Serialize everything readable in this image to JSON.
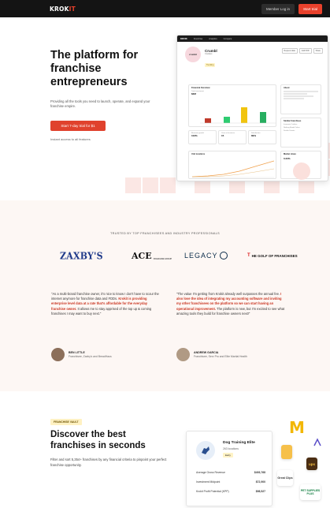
{
  "nav": {
    "logo_main": "KROK",
    "logo_accent": "IT",
    "login_label": "Member Log in",
    "trial_label": "Start trial"
  },
  "hero": {
    "title": "The platform for franchise entrepreneurs",
    "subtitle": "Providing all the tools you need to launch, operate, and expand your franchise empire.",
    "cta_label": "Start 7-day trial for $1",
    "instant_text": "Instant access to all features"
  },
  "dashboard": {
    "tabs_top": [
      "Franchise",
      "Analytics",
      "Compare"
    ],
    "brand_name": "Crumbl",
    "brand_logo_text": "crumbl",
    "brand_subtitle": "Cookies",
    "brand_badge": "Trending",
    "view_tabs": [
      "Request data",
      "Add FDD",
      "Share"
    ],
    "card_financial": {
      "title": "Financial Overview",
      "label": "Total investment",
      "value": "$2M"
    },
    "card_about": {
      "title": "About"
    },
    "card_similar": {
      "title": "Similar franchises",
      "items": [
        "Insomnia Cookies",
        "Nothing Bundt Cakes",
        "Dunkin Donuts"
      ]
    },
    "stats": [
      {
        "value": "103%",
        "label": "Revenue growth"
      },
      {
        "value": "15",
        "label": "Years in business"
      },
      {
        "value": "89%",
        "label": "Satisfaction"
      }
    ],
    "card_locations": {
      "title": "Unit locations"
    },
    "card_market": {
      "title": "Market share",
      "value": "0.23%"
    }
  },
  "trusted": {
    "label": "TRUSTED BY TOP FRANCHISEES AND INDUSTRY PROFESSIONALS",
    "brands": {
      "zaxbys": "ZAXBY'S",
      "ace": "ACE",
      "ace_sub": "FRANCHISE GROUP",
      "legacy": "LEGACY",
      "golf_tee": "T",
      "golf": "HE GOLF OF FRANCHISES"
    },
    "quote1": {
      "pre": "\"As a multi-brand franchise owner, it's nice to know I don't have to scour the internet anymore for franchise data and FDDs. ",
      "highlight": "Krokit is providing enterprise level data at a rate that's affordable for the everyday franchise owner.",
      "post": " It allows me to stay apprised of the top up & coming franchises I may want to buy next.\""
    },
    "quote2": {
      "pre": "\"The value I'm getting from Krokit already well surpasses the annual fee. ",
      "highlight": "I also love the idea of integrating my accounting software and inviting my other franchisees on the platform so we can start having an operational improvement.",
      "post": " The platform is new, but I'm excited to see what amazing tools they build for franchise owners next!\""
    },
    "person1": {
      "name": "BEN LITTLE",
      "role": "Franchisee, Zaxby's and BreadHaus"
    },
    "person2": {
      "name": "ANDREW GARCIA",
      "role": "Franchisee, Serv Pro and Elite Martial Health"
    }
  },
  "discover": {
    "pill": "FRANCHISE VAULT",
    "title": "Discover the best franchises in seconds",
    "subtitle": "Filter and sort 5,354+ franchises by any financial criteria to pinpoint your perfect franchise opportunity.",
    "card": {
      "name": "Dog Training Elite",
      "locations": "263 locations",
      "badge": "Early",
      "rows": [
        {
          "label": "Average Gross Revenue",
          "value": "$493,768"
        },
        {
          "label": "Investment Midpoint",
          "value": "$72,900"
        },
        {
          "label": "Krokit Profit Potential (KPP)",
          "value": "$98,527"
        }
      ]
    },
    "logos": {
      "mcd": "M",
      "ups": "ups",
      "great_clips": "Great Clips",
      "pet": "PET SUPPLIES PLUS"
    }
  },
  "colors": {
    "accent": "#e8412c",
    "dark": "#141414",
    "tint": "#fdf7f4"
  }
}
